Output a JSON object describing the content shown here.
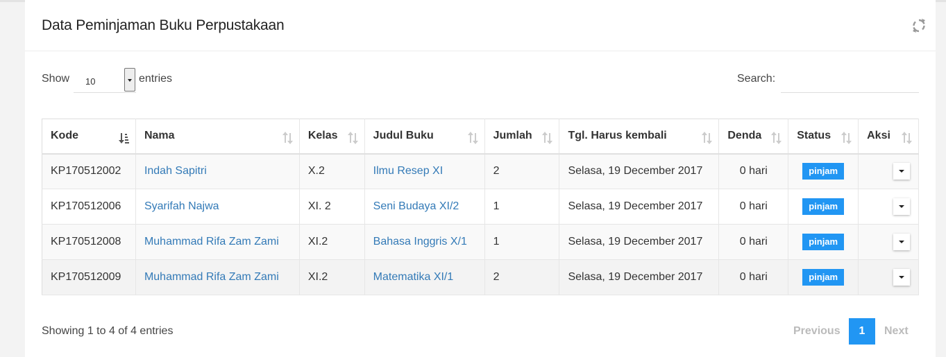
{
  "card": {
    "title": "Data Peminjaman Buku Perpustakaan"
  },
  "controls": {
    "show_label": "Show",
    "length_value": "10",
    "entries_label": "entries",
    "search_label": "Search:",
    "search_value": ""
  },
  "table": {
    "headers": [
      "Kode",
      "Nama",
      "Kelas",
      "Judul Buku",
      "Jumlah",
      "Tgl. Harus kembali",
      "Denda",
      "Status",
      "Aksi"
    ],
    "rows": [
      {
        "kode": "KP170512002",
        "nama": "Indah Sapitri",
        "kelas": "X.2",
        "judul": "Ilmu Resep XI",
        "jumlah": "2",
        "tgl": "Selasa, 19 December 2017",
        "denda": "0 hari",
        "status": "pinjam"
      },
      {
        "kode": "KP170512006",
        "nama": "Syarifah Najwa",
        "kelas": "XI. 2",
        "judul": "Seni Budaya XI/2",
        "jumlah": "1",
        "tgl": "Selasa, 19 December 2017",
        "denda": "0 hari",
        "status": "pinjam"
      },
      {
        "kode": "KP170512008",
        "nama": "Muhammad Rifa Zam Zami",
        "kelas": "XI.2",
        "judul": "Bahasa Inggris X/1",
        "jumlah": "1",
        "tgl": "Selasa, 19 December 2017",
        "denda": "0 hari",
        "status": "pinjam"
      },
      {
        "kode": "KP170512009",
        "nama": "Muhammad Rifa Zam Zami",
        "kelas": "XI.2",
        "judul": "Matematika XI/1",
        "jumlah": "2",
        "tgl": "Selasa, 19 December 2017",
        "denda": "0 hari",
        "status": "pinjam"
      }
    ]
  },
  "footer": {
    "info": "Showing 1 to 4 of 4 entries",
    "previous": "Previous",
    "current_page": "1",
    "next": "Next"
  },
  "colors": {
    "accent": "#2196f3",
    "link": "#337ab7"
  },
  "icons": {
    "refresh": "refresh-icon",
    "sort_active": "sort-amount-asc-icon",
    "sort": "sort-both-icon",
    "dropdown": "caret-down-icon"
  }
}
